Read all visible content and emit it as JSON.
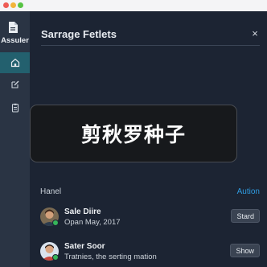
{
  "window": {
    "controls": [
      "close",
      "minimize",
      "maximize"
    ]
  },
  "sidebar": {
    "app_name": "Assuler",
    "logo_icon": "document-icon",
    "items": [
      {
        "icon": "home-icon",
        "active": true
      },
      {
        "icon": "edit-icon",
        "active": false
      },
      {
        "icon": "clipboard-icon",
        "active": false
      }
    ]
  },
  "panel": {
    "title": "Sarrage Fetlets",
    "close_label": "×"
  },
  "toast": {
    "text": "剪秋罗种子"
  },
  "list": {
    "section_label": "Hanel",
    "section_action": "Aution",
    "rows": [
      {
        "name": "Sale Diire",
        "subtitle": "Opan May, 2017",
        "button": "Stard"
      },
      {
        "name": "Sater Soor",
        "subtitle": "Tratnies, the serting mation",
        "button": "Show"
      }
    ]
  },
  "colors": {
    "sidebar_bg": "#2a3444",
    "active_nav": "#23606e",
    "main_bg": "#1c2433",
    "accent": "#2f9be0",
    "online": "#36b55a"
  }
}
